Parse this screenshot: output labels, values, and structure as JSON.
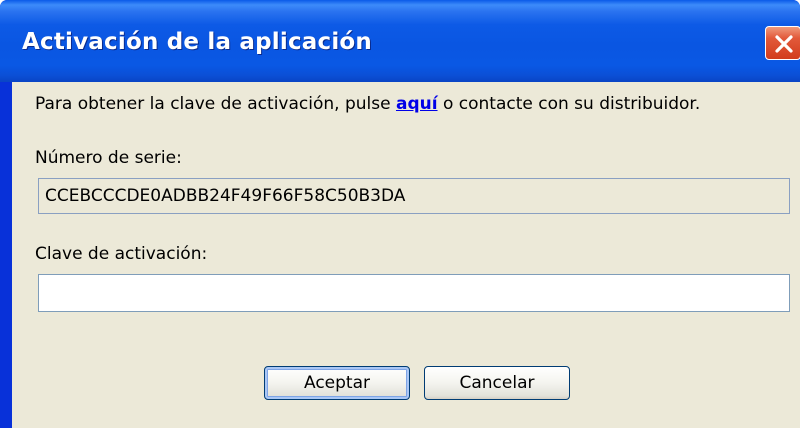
{
  "window": {
    "title": "Activación de la aplicación",
    "close_icon": "close-x-icon"
  },
  "intro": {
    "prefix": "Para obtener la clave de activación, pulse ",
    "link_label": "aquí",
    "suffix": " o contacte con su distribuidor."
  },
  "serial": {
    "label": "Número de serie:",
    "value": "CCEBCCCDE0ADBB24F49F66F58C50B3DA"
  },
  "activation": {
    "label": "Clave de activación:",
    "value": "",
    "placeholder": ""
  },
  "buttons": {
    "ok_label": "Aceptar",
    "cancel_label": "Cancelar"
  },
  "colors": {
    "titlebar": "#0a56e2",
    "client_bg": "#ece9d8",
    "close_red": "#d23c1c",
    "link": "#0000e8"
  }
}
